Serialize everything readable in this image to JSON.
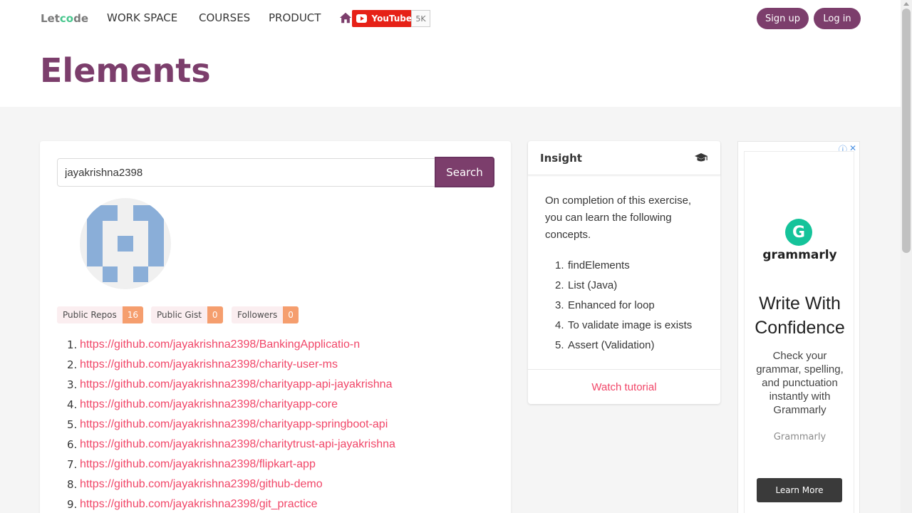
{
  "nav": {
    "logo_left": "Let",
    "logo_co": "co",
    "logo_right": "de",
    "items": [
      "WORK SPACE",
      "COURSES",
      "PRODUCT"
    ],
    "youtube_label": "YouTube",
    "youtube_count": "5K",
    "signup": "Sign up",
    "login": "Log in"
  },
  "hero": {
    "title": "Elements"
  },
  "search": {
    "value": "jayakrishna2398",
    "button": "Search"
  },
  "stats": [
    {
      "label": "Public Repos",
      "count": "16"
    },
    {
      "label": "Public Gist",
      "count": "0"
    },
    {
      "label": "Followers",
      "count": "0"
    }
  ],
  "repos": [
    "https://github.com/jayakrishna2398/BankingApplicatio-n",
    "https://github.com/jayakrishna2398/charity-user-ms",
    "https://github.com/jayakrishna2398/charityapp-api-jayakrishna",
    "https://github.com/jayakrishna2398/charityapp-core",
    "https://github.com/jayakrishna2398/charityapp-springboot-api",
    "https://github.com/jayakrishna2398/charitytrust-api-jayakrishna",
    "https://github.com/jayakrishna2398/flipkart-app",
    "https://github.com/jayakrishna2398/github-demo",
    "https://github.com/jayakrishna2398/git_practice"
  ],
  "insight": {
    "title": "Insight",
    "icon": "graduation-cap-icon",
    "description": "On completion of this exercise, you can learn the following concepts.",
    "concepts": [
      "findElements",
      "List (Java)",
      "Enhanced for loop",
      "To validate image is exists",
      "Assert (Validation)"
    ],
    "footer_link": "Watch tutorial"
  },
  "ad": {
    "brand_logo": "grammarly",
    "headline": "Write With Confidence",
    "copy": "Check your grammar, spelling, and punctuation instantly with Grammarly",
    "brand": "Grammarly",
    "cta": "Learn More"
  },
  "colors": {
    "primary": "#7c3e6c",
    "link": "#f14668",
    "tag_count": "#f59e6e",
    "youtube": "#e62117",
    "grammarly": "#15c39a"
  }
}
